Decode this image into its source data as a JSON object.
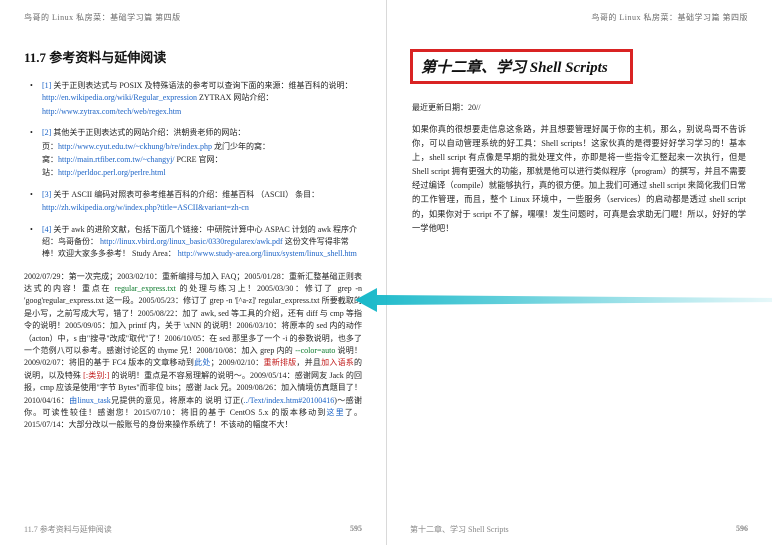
{
  "running_head": "鸟哥的 Linux 私房菜：基础学习篇 第四版",
  "left": {
    "section_title": "11.7 参考资料与延伸阅读",
    "refs": [
      {
        "n": "[1]",
        "body": "关于正则表达式与 POSIX 及特殊语法的参考可以查询下面的来源：维基百科的说明：",
        "links": [
          "http://en.wikipedia.org/wiki/Regular_expression",
          " ZYTRAX 网站介绍：",
          "http://www.zytrax.com/tech/web/regex.htm"
        ]
      },
      {
        "n": "[2]",
        "body": "其他关于正则表达式的网站介绍：洪朝贵老师的网站：",
        "links": [
          "http://www.cyut.edu.tw/~ckhung/b/re/index.php",
          " 龙门少年的窝：",
          "http://main.rtfiber.com.tw/~changyj/",
          " PCRE 官网：",
          "http://perldoc.perl.org/perlre.html"
        ]
      },
      {
        "n": "[3]",
        "body": "关于 ASCII 编码对照表可参考维基百科的介绍：维基百科 （ASCII） 条目：",
        "links": [
          "http://zh.wikipedia.org/w/index.php?title=ASCII&variant=zh-cn"
        ]
      },
      {
        "n": "[4]",
        "body": "关于 awk 的进阶文献，包括下面几个链接：中研院计算中心 ASPAC 计划的 awk 程序介绍：鸟哥备份：",
        "links": [
          "http://linux.vbird.org/linux_basic/0330regularex/awk.pdf",
          " 这份文件写得非常棒！欢迎大家多多参考！ Study Area：",
          "http://www.study-area.org/linux/system/linux_shell.htm"
        ]
      }
    ],
    "changelog": "2002/07/29：第一次完成；2003/02/10：重新编排与加入 FAQ；2005/01/28：重新汇整基础正则表达式的内容！重点在 regular_express.txt 的处理与练习上！2005/03/30：修订了 grep -n 'goog'regular_express.txt 这一段。2005/05/23：修订了 grep -n '[^a-z]' regular_express.txt 所要截取的是小写，之前写成大写，错了！2005/08/22：加了 awk, sed 等工具的介绍，还有 diff 与 cmp 等指令的说明！2005/09/05：加入 printf 内，关于 \\xNN 的说明！2006/03/10：将原本的 sed 内的动作（action）中，s 由\"搜寻\"改成\"取代\"了！2006/10/05：在 sed 那里多了一个 -i 的参数说明，也多了一个范例八可以参考。感谢讨论区的 thyme 兄！2008/10/08：加入 grep 内的 --color=auto 说明！2009/02/07：将旧的基于 FC4 版本的文章移动到此处；2009/02/10：重新排版，并且加入语系的说明，以及特殊 [:类别:] 的说明！重点是不容易理解的说明～。2009/05/14：感谢网友 Jack 的回报，cmp 应该是使用\"字节 Bytes\"而非位 bits；感谢 Jack 兄。2009/08/26：加入情境仿真题目了！2010/04/16：由 linux_task 兄提供的意见，将原本的 说明 订正(../Text/index.htm#20100416)～感谢你。可读性较佳！感谢您！2015/07/10：将旧的基于 CentOS 5.x 的版本移动到这里了。2015/07/14：大部分改以一般账号的身份来操作系统了！不该动的幅度不大！",
    "footer_title": "11.7 参考资料与延伸阅读",
    "footer_page": "595"
  },
  "right": {
    "chapter_title": "第十二章、学习 Shell Scripts",
    "updated_label": "最近更新日期：",
    "updated_value": "20//",
    "intro": "如果你真的很想要走信息这条路，并且想要管理好属于你的主机，那么，别说鸟哥不告诉你，可以自动管理系统的好工具：Shell scripts！这家伙真的是得要好好学习学习的！基本上，shell script 有点像是早期的批处理文件，亦即是将一些指令汇整起来一次执行，但是 Shell script 拥有更强大的功能，那就是他可以进行类似程序（program）的撰写，并且不需要经过编译（compile）就能够执行，真的很方便。加上我们可通过 shell script 来简化我们日常的工作管理，而且，整个 Linux 环境中，一些服务（services）的启动都是透过 shell script 的，如果你对于 script 不了解，嘿嘿！发生问题时，可真是会求助无门喔！所以，好好的学一学他吧！",
    "footer_title": "第十二章、学习 Shell Scripts",
    "footer_page": "596"
  }
}
